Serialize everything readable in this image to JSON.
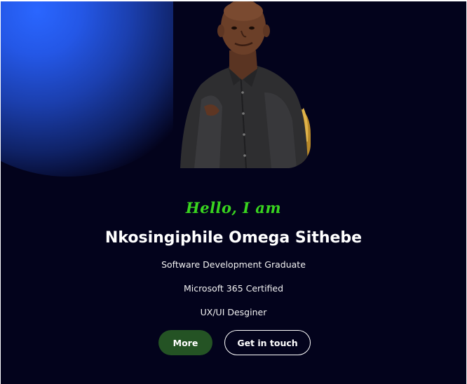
{
  "hero": {
    "greeting": "Hello, I am",
    "name": "Nkosingiphile Omega Sithebe",
    "roles": [
      "Software Development Graduate",
      "Microsoft 365 Certified",
      "UX/UI Desginer"
    ]
  },
  "actions": {
    "more_label": "More",
    "contact_label": "Get in touch"
  },
  "colors": {
    "background": "#03031c",
    "glow": "#2a66ff",
    "greeting": "#39d51f",
    "more_button": "#245324"
  }
}
